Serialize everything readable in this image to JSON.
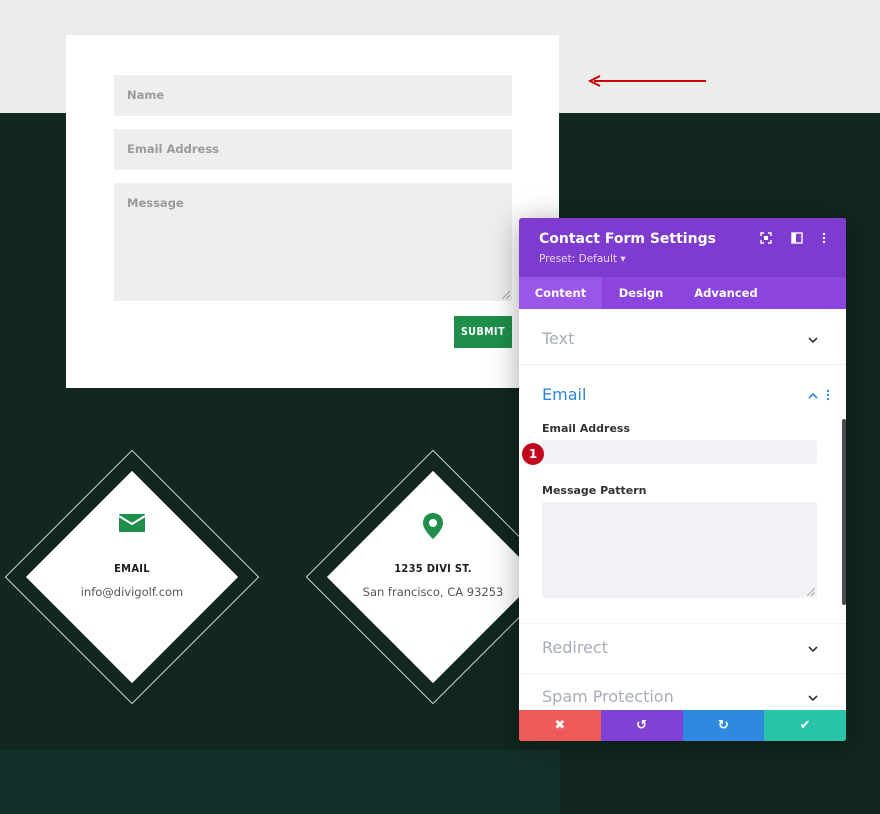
{
  "form": {
    "name_placeholder": "Name",
    "email_placeholder": "Email Address",
    "message_placeholder": "Message",
    "submit_label": "SUBMIT"
  },
  "cards": [
    {
      "icon": "envelope-icon",
      "title": "EMAIL",
      "text": "info@divigolf.com"
    },
    {
      "icon": "map-pin-icon",
      "title": "1235 DIVI ST.",
      "text": "San francisco, CA 93253"
    }
  ],
  "panel": {
    "title": "Contact Form Settings",
    "preset": "Preset: Default ▾",
    "tabs": [
      "Content",
      "Design",
      "Advanced"
    ],
    "active_tab": "Content",
    "sections": {
      "text": "Text",
      "email": "Email",
      "redirect": "Redirect",
      "spam": "Spam Protection"
    },
    "email_address_label": "Email Address",
    "email_address_value": "",
    "message_pattern_label": "Message Pattern",
    "message_pattern_value": "",
    "badge_number": "1",
    "footer": {
      "cancel_icon": "✖",
      "undo_icon": "↺",
      "redo_icon": "↻",
      "save_icon": "✔"
    }
  },
  "colors": {
    "accent_purple": "#7e3bd0",
    "submit_green": "#1f8f4b",
    "icon_green": "#1f8f4b",
    "arrow_red": "#cc0000",
    "cancel_red": "#ef5b5b",
    "undo_purple": "#8042d4",
    "redo_blue": "#2e8ae0",
    "save_teal": "#29c4a9"
  }
}
